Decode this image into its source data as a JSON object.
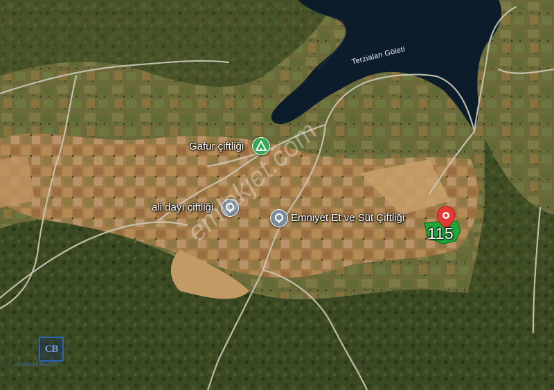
{
  "map": {
    "type": "satellite",
    "colors": {
      "lake": "#0c1c2a",
      "forest": "#3e4f25",
      "field": "#b88a55",
      "road": "#cfc8b8",
      "parcel_fill": "#22a83a",
      "red_pin": "#e53935",
      "green_pin_icon": "#34a853",
      "gray_pin_icon": "#7a8a99"
    }
  },
  "labels": {
    "lake": "Terzialan Göleti",
    "gafur": "Gafur çiftliği",
    "ali_dayi": "ali dayı çiftliği",
    "emniyet": "Emniyet Et ve Süt Çiftliği"
  },
  "parcel": {
    "number": "115"
  },
  "icons": {
    "gafur_pin": "campground-icon",
    "ali_dayi_pin": "place-pin-icon",
    "emniyet_pin": "place-pin-icon",
    "parcel_pin": "location-pin-icon"
  }
}
